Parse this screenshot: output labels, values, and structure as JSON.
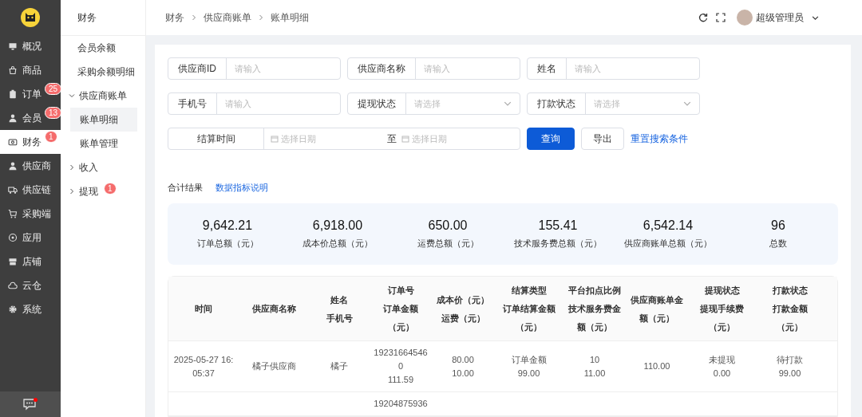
{
  "nav": [
    {
      "label": "概况",
      "selected": false
    },
    {
      "label": "商品",
      "selected": false
    },
    {
      "label": "订单",
      "selected": false,
      "badge": "25"
    },
    {
      "label": "会员",
      "selected": false,
      "badge": "13"
    },
    {
      "label": "财务",
      "selected": true,
      "badge": "1"
    },
    {
      "label": "供应商",
      "selected": false
    },
    {
      "label": "供应链",
      "selected": false
    },
    {
      "label": "采购端",
      "selected": false
    },
    {
      "label": "应用",
      "selected": false
    },
    {
      "label": "店铺",
      "selected": false
    },
    {
      "label": "云仓",
      "selected": false
    },
    {
      "label": "系统",
      "selected": false
    }
  ],
  "submenu": {
    "title": "财务",
    "items": [
      {
        "kind": "item",
        "label": "会员余额",
        "selected": false
      },
      {
        "kind": "item",
        "label": "采购余额明细",
        "selected": false
      },
      {
        "kind": "group",
        "label": "供应商账单",
        "expanded": true,
        "children": [
          {
            "label": "账单明细",
            "selected": true
          },
          {
            "label": "账单管理",
            "selected": false
          }
        ]
      },
      {
        "kind": "group",
        "label": "收入",
        "expanded": false
      },
      {
        "kind": "group",
        "label": "提现",
        "expanded": false,
        "badge": "1"
      }
    ]
  },
  "breadcrumb": [
    "财务",
    "供应商账单",
    "账单明细"
  ],
  "user": {
    "name": "超级管理员"
  },
  "filters": [
    {
      "kind": "input",
      "label": "供应商ID",
      "placeholder": "请输入"
    },
    {
      "kind": "input",
      "label": "供应商名称",
      "placeholder": "请输入"
    },
    {
      "kind": "input",
      "label": "姓名",
      "placeholder": "请输入"
    },
    {
      "kind": "input",
      "label": "手机号",
      "placeholder": "请输入"
    },
    {
      "kind": "select",
      "label": "提现状态",
      "placeholder": "请选择"
    },
    {
      "kind": "select",
      "label": "打款状态",
      "placeholder": "请选择"
    }
  ],
  "date_range": {
    "label": "结算时间",
    "start_placeholder": "选择日期",
    "separator": "至",
    "end_placeholder": "选择日期"
  },
  "actions": {
    "search": "查询",
    "export": "导出",
    "reset": "重置搜索条件"
  },
  "summary": {
    "title": "合计结果",
    "help_link": "数据指标说明",
    "stats": [
      {
        "value": "9,642.21",
        "label": "订单总额（元）"
      },
      {
        "value": "6,918.00",
        "label": "成本价总额（元）"
      },
      {
        "value": "650.00",
        "label": "运费总额（元）"
      },
      {
        "value": "155.41",
        "label": "技术服务费总额（元）"
      },
      {
        "value": "6,542.14",
        "label": "供应商账单总额（元）"
      },
      {
        "value": "96",
        "label": "总数"
      }
    ]
  },
  "table": {
    "columns": [
      {
        "lines": [
          "时间"
        ]
      },
      {
        "lines": [
          "供应商名称"
        ]
      },
      {
        "lines": [
          "姓名",
          "手机号"
        ]
      },
      {
        "lines": [
          "订单号",
          "订单金额",
          "（元）"
        ]
      },
      {
        "lines": [
          "成本价（元）",
          "运费（元）"
        ]
      },
      {
        "lines": [
          "结算类型",
          "订单结算金额",
          "（元）"
        ]
      },
      {
        "lines": [
          "平台扣点比例",
          "技术服务费金",
          "额（元）"
        ]
      },
      {
        "lines": [
          "供应商账单金",
          "额（元）"
        ]
      },
      {
        "lines": [
          "提现状态",
          "提现手续费",
          "（元）"
        ]
      },
      {
        "lines": [
          "打款状态",
          "打款金额",
          "（元）"
        ]
      }
    ],
    "rows": [
      {
        "cells": [
          [
            "2025-05-27 16:",
            "05:37"
          ],
          [
            "橘子供应商"
          ],
          [
            "橘子"
          ],
          [
            "19231664546",
            "0",
            "111.59"
          ],
          [
            "80.00",
            "10.00"
          ],
          [
            "订单金额",
            "99.00"
          ],
          [
            "10",
            "11.00"
          ],
          [
            "110.00"
          ],
          [
            "未提现",
            "0.00"
          ],
          [
            "待打款",
            "99.00"
          ]
        ]
      },
      {
        "cells": [
          [],
          [],
          [],
          [
            "19204875936"
          ],
          [],
          [],
          [],
          [],
          [],
          []
        ]
      }
    ]
  }
}
